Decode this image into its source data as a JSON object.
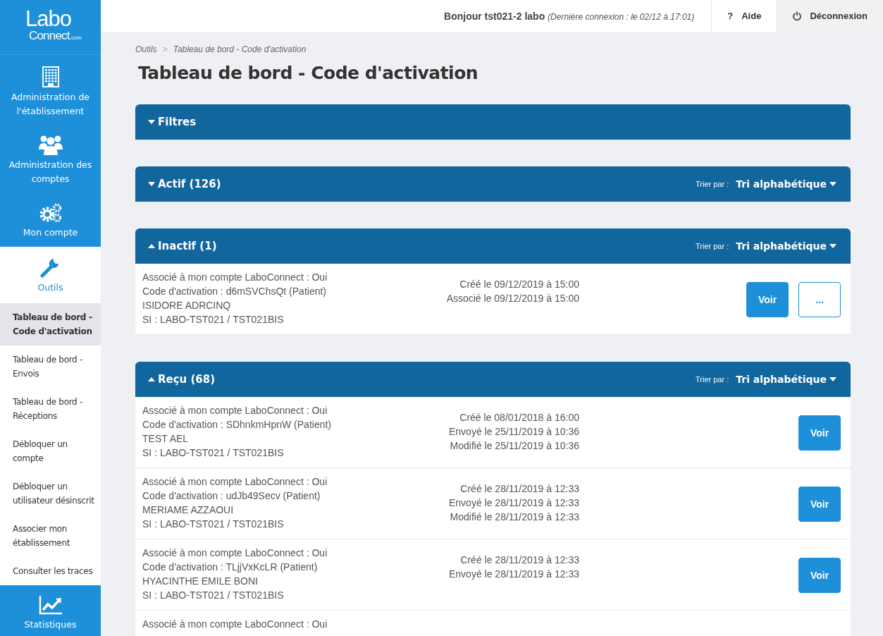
{
  "logo": {
    "line1": "Labo",
    "line2": "Connect",
    "suffix": ".com"
  },
  "nav": [
    {
      "label": "Administration de l'établissement",
      "selected": false
    },
    {
      "label": "Administration des comptes",
      "selected": false
    },
    {
      "label": "Mon compte",
      "selected": false
    },
    {
      "label": "Outils",
      "selected": true,
      "children": [
        {
          "label": "Tableau de bord - Code d'activation",
          "selected": true
        },
        {
          "label": "Tableau de bord - Envois",
          "selected": false
        },
        {
          "label": "Tableau de bord - Réceptions",
          "selected": false
        },
        {
          "label": "Débloquer un compte",
          "selected": false
        },
        {
          "label": "Débloquer un utilisateur désinscrit",
          "selected": false
        },
        {
          "label": "Associer mon établissement",
          "selected": false
        },
        {
          "label": "Consulter les traces",
          "selected": false
        }
      ]
    },
    {
      "label": "Statistiques",
      "selected": false
    }
  ],
  "header": {
    "greeting": "Bonjour tst021-2 labo",
    "last_login": "(Dernière connexion : le 02/12 à 17:01)",
    "help": "Aide",
    "logout": "Déconnexion",
    "help_icon": "?"
  },
  "breadcrumb": [
    "Outils",
    "Tableau de bord - Code d'activation"
  ],
  "breadcrumb_separator": ">",
  "title": "Tableau de bord - Code d'activation",
  "sections": [
    {
      "title": "Filtres",
      "expanded": false
    },
    {
      "title": "Actif (126)",
      "expanded": false,
      "sort_label": "Trier par :",
      "sort_value": "Tri alphabétique"
    },
    {
      "title": "Inactif (1)",
      "expanded": true,
      "sort_label": "Trier par :",
      "sort_value": "Tri alphabétique",
      "rows": [
        {
          "lines": [
            "Associé à mon compte LaboConnect : Oui",
            "Code d'activation : d6mSVChsQt (Patient)",
            "ISIDORE ADRCINQ",
            "SI : LABO-TST021 / TST021BIS"
          ],
          "dates": [
            "Créé le 09/12/2019 à 15:00",
            "Associé le 09/12/2019 à 15:00"
          ],
          "actions": [
            {
              "kind": "primary",
              "label": "Voir"
            },
            {
              "kind": "outline",
              "label": "..."
            }
          ]
        }
      ]
    },
    {
      "title": "Reçu (68)",
      "expanded": true,
      "sort_label": "Trier par :",
      "sort_value": "Tri alphabétique",
      "rows": [
        {
          "lines": [
            "Associé à mon compte LaboConnect : Oui",
            "Code d'activation : SDhnkmHpnW (Patient)",
            "TEST AEL",
            "SI : LABO-TST021 / TST021BIS"
          ],
          "dates": [
            "Créé le 08/01/2018 à 16:00",
            "Envoyé le 25/11/2019 à 10:36",
            "Modifié le 25/11/2019 à 10:36"
          ],
          "actions": [
            {
              "kind": "primary",
              "label": "Voir"
            }
          ]
        },
        {
          "lines": [
            "Associé à mon compte LaboConnect : Oui",
            "Code d'activation : udJb49Secv (Patient)",
            "MERIAME AZZAOUI",
            "SI : LABO-TST021 / TST021BIS"
          ],
          "dates": [
            "Créé le 28/11/2019 à 12:33",
            "Envoyé le 28/11/2019 à 12:33",
            "Modifié le 28/11/2019 à 12:33"
          ],
          "actions": [
            {
              "kind": "primary",
              "label": "Voir"
            }
          ]
        },
        {
          "lines": [
            "Associé à mon compte LaboConnect : Oui",
            "Code d'activation : TLjjVxKcLR (Patient)",
            "HYACINTHE EMILE BONI",
            "SI : LABO-TST021 / TST021BIS"
          ],
          "dates": [
            "Créé le 28/11/2019 à 12:33",
            "Envoyé le 28/11/2019 à 12:33"
          ],
          "actions": [
            {
              "kind": "primary",
              "label": "Voir"
            }
          ]
        },
        {
          "lines": [
            "Associé à mon compte LaboConnect : Oui"
          ]
        }
      ]
    }
  ]
}
